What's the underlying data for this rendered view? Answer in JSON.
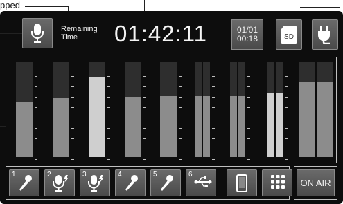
{
  "callout": {
    "text": "pped"
  },
  "header": {
    "remaining_line1": "Remaining",
    "remaining_line2": "Time",
    "clock": "01:42:11",
    "date_line1": "01/01",
    "date_line2": "00:18",
    "sd_label": "SD"
  },
  "meters": {
    "channels": [
      {
        "level": 0.57,
        "peak": 0.82,
        "hot": false,
        "stereo": false
      },
      {
        "level": 0.62,
        "peak": 0.72,
        "hot": false,
        "stereo": false
      },
      {
        "level": 0.83,
        "peak": 0.62,
        "hot": true,
        "stereo": false
      },
      {
        "level": 0.63,
        "peak": 0.58,
        "hot": false,
        "stereo": false
      },
      {
        "level": 0.64,
        "peak": 0.58,
        "hot": false,
        "stereo": false
      },
      {
        "level": 0.64,
        "peak": 0.58,
        "hot": false,
        "stereo": true
      },
      {
        "level": 0.64,
        "peak": 0.58,
        "hot": false,
        "stereo": true
      },
      {
        "level": 0.67,
        "peak": 0.58,
        "hot": true,
        "stereo": true
      },
      {
        "level": 0.79,
        "peak": 0.55,
        "hot": false,
        "stereo": true
      }
    ]
  },
  "footer": {
    "inputs": [
      {
        "num": "1",
        "icon": "handheld-mic-icon"
      },
      {
        "num": "2",
        "icon": "phantom-mic-icon"
      },
      {
        "num": "3",
        "icon": "phantom-mic-icon"
      },
      {
        "num": "4",
        "icon": "handheld-mic-icon"
      },
      {
        "num": "5",
        "icon": "handheld-mic-icon"
      },
      {
        "num": "6",
        "icon": "usb-icon"
      },
      {
        "num": "",
        "icon": "smartphone-icon"
      },
      {
        "num": "",
        "icon": "grid-menu-icon"
      }
    ],
    "onair_label": "ON AIR"
  }
}
